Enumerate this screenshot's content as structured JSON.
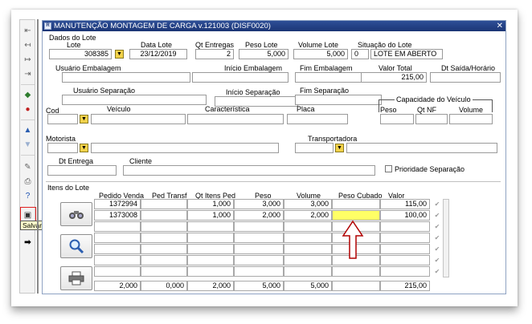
{
  "window": {
    "title": "MANUTENÇÃO MONTAGEM DE CARGA v.121003 (DISF0020)",
    "icon_text": "R",
    "close_symbol": "✕"
  },
  "toolbar": {
    "icons": [
      "first-record-icon",
      "prev-record-icon",
      "next-record-icon",
      "last-record-icon",
      "refresh-icon",
      "insert-icon",
      "delete-icon",
      "up-icon",
      "down-icon",
      "edit-icon",
      "print-icon",
      "help-icon",
      "save-icon",
      "exit-icon"
    ],
    "tooltip": "Salvar"
  },
  "dados_lote": {
    "section_label": "Dados do Lote",
    "lote_label": "Lote",
    "lote_value": "308385",
    "data_lote_label": "Data Lote",
    "data_lote_value": "23/12/2019",
    "qt_entregas_label": "Qt Entregas",
    "qt_entregas_value": "2",
    "peso_lote_label": "Peso Lote",
    "peso_lote_value": "5,000",
    "volume_lote_label": "Volume Lote",
    "volume_lote_value": "5,000",
    "situacao_label": "Situação do Lote",
    "situacao_code": "0",
    "situacao_value": "LOTE EM ABERTO"
  },
  "embalagem": {
    "usuario_label": "Usuário Embalagem",
    "usuario_value": "",
    "inicio_label": "Início Embalagem",
    "inicio_value": "",
    "fim_label": "Fim Embalagem",
    "fim_value": "",
    "valor_total_label": "Valor Total",
    "valor_total_value": "215,00",
    "dt_saida_label": "Dt Saída/Horário",
    "dt_saida_value": ""
  },
  "separacao": {
    "usuario_label": "Usuário Separação",
    "inicio_label": "Início Separação",
    "fim_label": "Fim Separação"
  },
  "veiculo": {
    "cod_label": "Cod",
    "veiculo_label": "Veículo",
    "caracteristica_label": "Característica",
    "placa_label": "Placa",
    "capacidade_label": "Capacidade do Veículo",
    "cap_peso_label": "Peso",
    "cap_qtnf_label": "Qt NF",
    "cap_volume_label": "Volume"
  },
  "motorista": {
    "motorista_label": "Motorista",
    "transportadora_label": "Transportadora"
  },
  "entrega": {
    "dt_entrega_label": "Dt Entrega",
    "cliente_label": "Cliente",
    "prioridade_label": "Prioridade Separação",
    "prioridade_checked": false
  },
  "itens": {
    "section_label": "Itens do Lote",
    "columns": [
      "Pedido Venda",
      "Ped Transf",
      "Qt Itens Ped",
      "Peso",
      "Volume",
      "Peso Cubado",
      "Valor"
    ],
    "rows": [
      [
        "1372994",
        "",
        "1,000",
        "3,000",
        "3,000",
        "",
        "115,00"
      ],
      [
        "1373008",
        "",
        "1,000",
        "2,000",
        "2,000",
        "",
        "100,00"
      ],
      [
        "",
        "",
        "",
        "",
        "",
        "",
        ""
      ],
      [
        "",
        "",
        "",
        "",
        "",
        "",
        ""
      ],
      [
        "",
        "",
        "",
        "",
        "",
        "",
        ""
      ],
      [
        "",
        "",
        "",
        "",
        "",
        "",
        ""
      ],
      [
        "",
        "",
        "",
        "",
        "",
        "",
        ""
      ]
    ],
    "totals": [
      "2,000",
      "0,000",
      "2,000",
      "5,000",
      "5,000",
      "",
      "215,00"
    ]
  },
  "colors": {
    "titlebar": "#1b3575",
    "highlight_cell": "#ffff66",
    "annotation": "#e02020",
    "arrow": "#b00000"
  }
}
